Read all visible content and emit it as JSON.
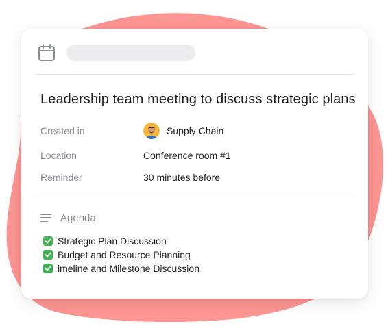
{
  "colors": {
    "blob": "#fd9593",
    "card": "#ffffff",
    "label": "#8a8d94",
    "text": "#1f1f24",
    "check": "#3fb34f",
    "placeholder": "#ececee"
  },
  "header": {
    "icon": "calendar-icon"
  },
  "meeting": {
    "title": "Leadership team meeting to discuss strategic plans"
  },
  "details": {
    "created_in": {
      "label": "Created in",
      "value": "Supply Chain",
      "icon": "avatar"
    },
    "location": {
      "label": "Location",
      "value": "Conference room #1"
    },
    "reminder": {
      "label": "Reminder",
      "value": "30 minutes before"
    }
  },
  "agenda": {
    "icon": "lines-icon",
    "title": "Agenda",
    "items": [
      {
        "text": "Strategic Plan Discussion",
        "icon": "check-icon"
      },
      {
        "text": "Budget and Resource Planning",
        "icon": "check-icon"
      },
      {
        "text": "imeline and Milestone Discussion",
        "icon": "check-icon"
      }
    ]
  }
}
